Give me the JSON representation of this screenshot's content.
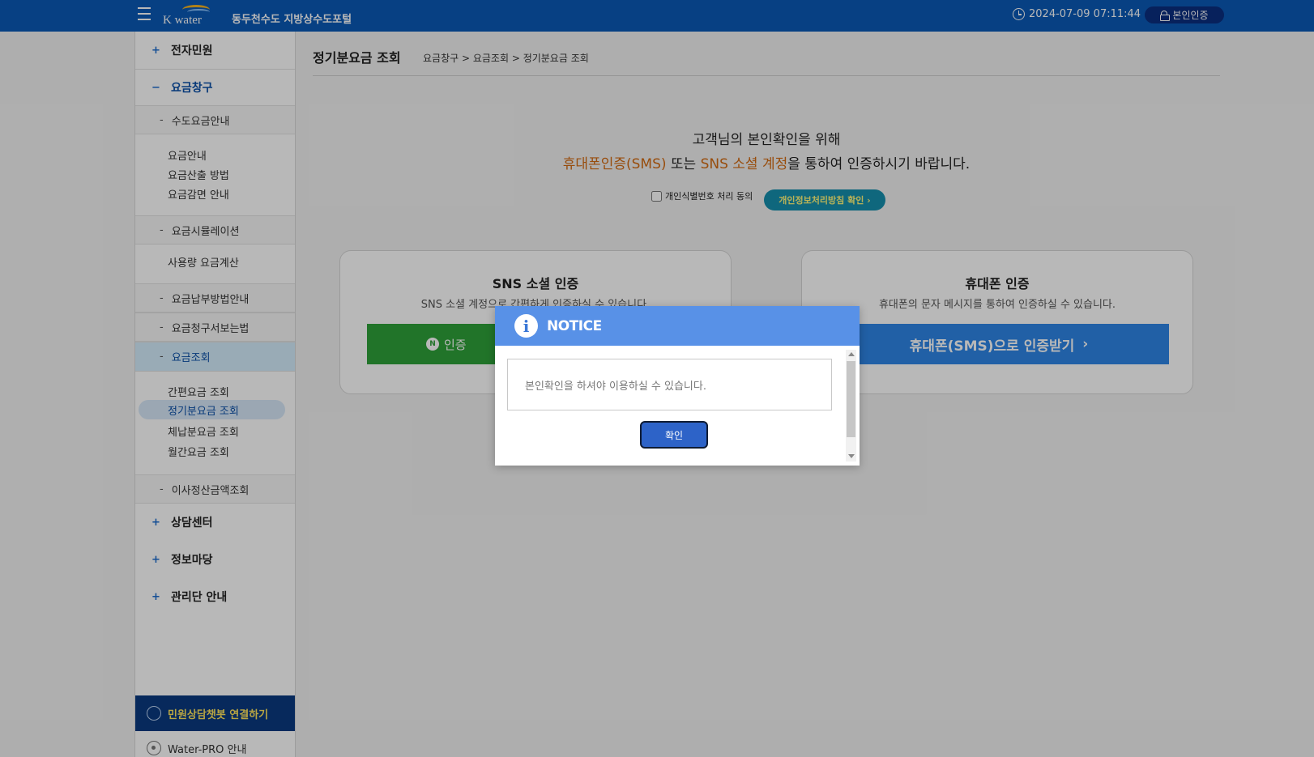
{
  "header": {
    "logo_text": "K water",
    "site_title": "동두천수도 지방상수도포털",
    "datetime": "2024-07-09 07:11:44",
    "auth_label": "본인인증"
  },
  "sidebar": {
    "menu1": "전자민원",
    "menu2": "요금창구",
    "sub1": "수도요금안내",
    "leaf1": "요금안내",
    "leaf2": "요금산출 방법",
    "leaf3": "요금감면 안내",
    "sub2": "요금시뮬레이션",
    "leaf4": "사용량 요금계산",
    "sub3": "요금납부방법안내",
    "sub4": "요금청구서보는법",
    "sub5": "요금조회",
    "leaf5": "간편요금 조회",
    "leaf6": "정기분요금 조회",
    "leaf7": "체납분요금 조회",
    "leaf8": "월간요금 조회",
    "sub6": "이사정산금액조회",
    "menu3": "상담센터",
    "menu4": "정보마당",
    "menu5": "관리단 안내",
    "chatbot": "민원상담챗봇 연결하기",
    "waterpro": "Water-PRO 안내",
    "plus": "+",
    "minus": "−",
    "dash": "-"
  },
  "main": {
    "page_title": "정기분요금 조회",
    "breadcrumb": "요금창구 > 요금조회 > 정기분요금 조회",
    "notice_line1": "고객님의 본인확인을 위해",
    "notice_sms": "휴대폰인증(SMS)",
    "notice_or": " 또는 ",
    "notice_sns": "SNS 소셜 계정",
    "notice_rest": "을 통하여 인증하시기 바랍니다.",
    "consent_label": "개인식별번호 처리 동의",
    "policy_button": "개인정보처리방침 확인 ›",
    "sns_card": {
      "title": "SNS 소셜 인증",
      "desc": "SNS 소셜 계정으로 간편하게 인증하실 수 있습니다.",
      "button": "인증",
      "naver_logo": "N"
    },
    "phone_card": {
      "title": "휴대폰 인증",
      "desc": "휴대폰의 문자 메시지를 통하여 인증하실 수 있습니다.",
      "button": "휴대폰(SMS)으로 인증받기",
      "arrow": "›"
    }
  },
  "modal": {
    "title": "NOTICE",
    "icon_glyph": "i",
    "message": "본인확인을 하셔야 이용하실 수 있습니다.",
    "ok_button": "확인"
  },
  "colors": {
    "header": "#0b59b6",
    "modal_header": "#5891e7",
    "highlight": "#d36b12",
    "naver_green": "#2fa13a",
    "sms_blue": "#2f86e6"
  }
}
